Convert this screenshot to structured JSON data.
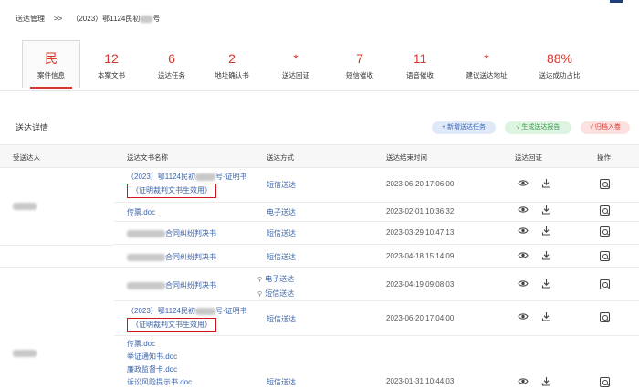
{
  "breadcrumb": {
    "root": "送达管理",
    "sep": ">>",
    "case_prefix": "（2023）鄂1124民初",
    "case_suffix": "号"
  },
  "stats": [
    {
      "value": "民",
      "label": "案件信息"
    },
    {
      "value": "12",
      "label": "本案文书"
    },
    {
      "value": "6",
      "label": "送达任务"
    },
    {
      "value": "2",
      "label": "地址确认书"
    },
    {
      "value": "*",
      "label": "送达回证"
    },
    {
      "value": "7",
      "label": "短信催收"
    },
    {
      "value": "11",
      "label": "语音催收"
    },
    {
      "value": "*",
      "label": "建议送达地址"
    },
    {
      "value": "88%",
      "label": "送达成功占比"
    }
  ],
  "section": {
    "title": "送达详情"
  },
  "actions": {
    "new_task": "+ 新增送达任务",
    "gen_report": "√ 生成送达报告",
    "archive": "√ 归档入卷"
  },
  "table": {
    "headers": [
      "受送达人",
      "送达文书名称",
      "送达方式",
      "送达结束时间",
      "送达回证",
      "操作"
    ],
    "rows": [
      {
        "doc_prefix": "（2023）鄂1124民初",
        "doc_suffix": "号-证明书",
        "doc_boxed": "（证明裁判文书生效用）",
        "method": "短信送达",
        "time": "2023-06-20 17:06:00"
      },
      {
        "doc": "传票.doc",
        "method": "电子送达",
        "time": "2023-02-01 10:36:32"
      },
      {
        "doc_suffix": "合同纠纷判决书",
        "method": "短信送达",
        "time": "2023-03-29 10:47:13"
      },
      {
        "doc_suffix": "合同纠纷判决书",
        "method": "短信送达",
        "time": "2023-04-18 15:14:09"
      },
      {
        "doc_suffix": "合同纠纷判决书",
        "method": "电子送达",
        "method2": "短信送达",
        "time": "2023-04-19 09:08:03"
      },
      {
        "doc_prefix": "（2023）鄂1124民初",
        "doc_suffix": "号-证明书",
        "doc_boxed": "（证明裁判文书生效用）",
        "method": "短信送达",
        "time": "2023-06-20 17:04:00"
      },
      {
        "docs": [
          "传票.doc",
          "举证通知书.doc",
          "廉政监督卡.doc",
          "诉讼风险提示书.doc"
        ],
        "method": "短信送达",
        "time": "2023-01-31 10:44:03"
      }
    ]
  },
  "icons": {
    "view": "eye-icon",
    "download": "download-icon",
    "operate": "search-doc-icon"
  }
}
